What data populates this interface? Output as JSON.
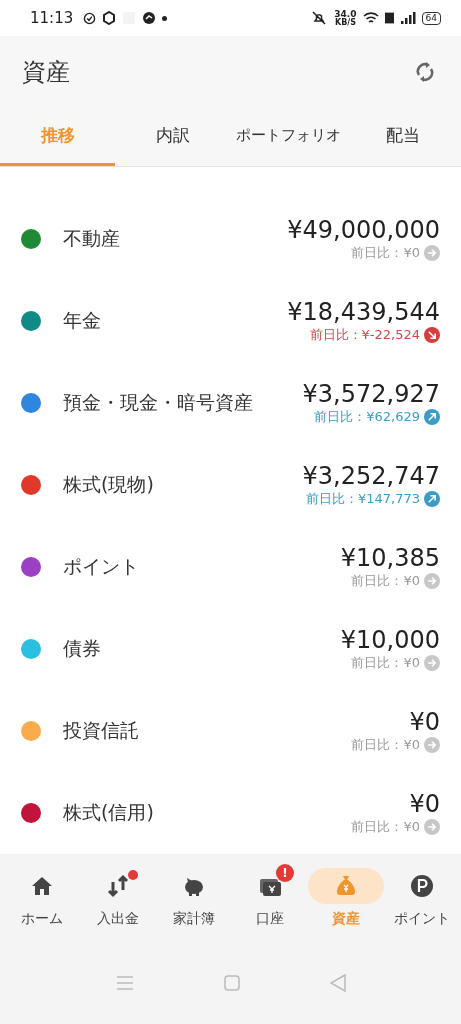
{
  "status_bar": {
    "time": "11:13",
    "speed": "34.0",
    "speed_unit": "KB/S",
    "battery": "64"
  },
  "header": {
    "title": "資産"
  },
  "tabs": [
    {
      "label": "推移",
      "selected": true
    },
    {
      "label": "内訳",
      "selected": false
    },
    {
      "label": "ポートフォリオ",
      "selected": false
    },
    {
      "label": "配当",
      "selected": false
    }
  ],
  "assets": [
    {
      "name": "不動産",
      "color": "#1e8a34",
      "amount": "¥49,000,000",
      "change": "前日比：¥0",
      "kind": "flat"
    },
    {
      "name": "年金",
      "color": "#0f8a86",
      "amount": "¥18,439,544",
      "change": "前日比：¥-22,524",
      "kind": "down"
    },
    {
      "name": "預金・現金・暗号資産",
      "color": "#2e86de",
      "amount": "¥3,572,927",
      "change": "前日比：¥62,629",
      "kind": "up"
    },
    {
      "name": "株式(現物)",
      "color": "#e0392b",
      "amount": "¥3,252,747",
      "change": "前日比：¥147,773",
      "kind": "up"
    },
    {
      "name": "ポイント",
      "color": "#9b3fc4",
      "amount": "¥10,385",
      "change": "前日比：¥0",
      "kind": "flat"
    },
    {
      "name": "債券",
      "color": "#2bc0df",
      "amount": "¥10,000",
      "change": "前日比：¥0",
      "kind": "flat"
    },
    {
      "name": "投資信託",
      "color": "#fbac4a",
      "amount": "¥0",
      "change": "前日比：¥0",
      "kind": "flat"
    },
    {
      "name": "株式(信用)",
      "color": "#c0143c",
      "amount": "¥0",
      "change": "前日比：¥0",
      "kind": "flat"
    }
  ],
  "bottom_nav": [
    {
      "label": "ホーム",
      "selected": false
    },
    {
      "label": "入出金",
      "selected": false,
      "badge": {
        "kind": "dot"
      }
    },
    {
      "label": "家計簿",
      "selected": false
    },
    {
      "label": "口座",
      "selected": false,
      "badge": {
        "kind": "alert",
        "text": "!"
      }
    },
    {
      "label": "資産",
      "selected": true
    },
    {
      "label": "ポイント",
      "selected": false
    }
  ]
}
